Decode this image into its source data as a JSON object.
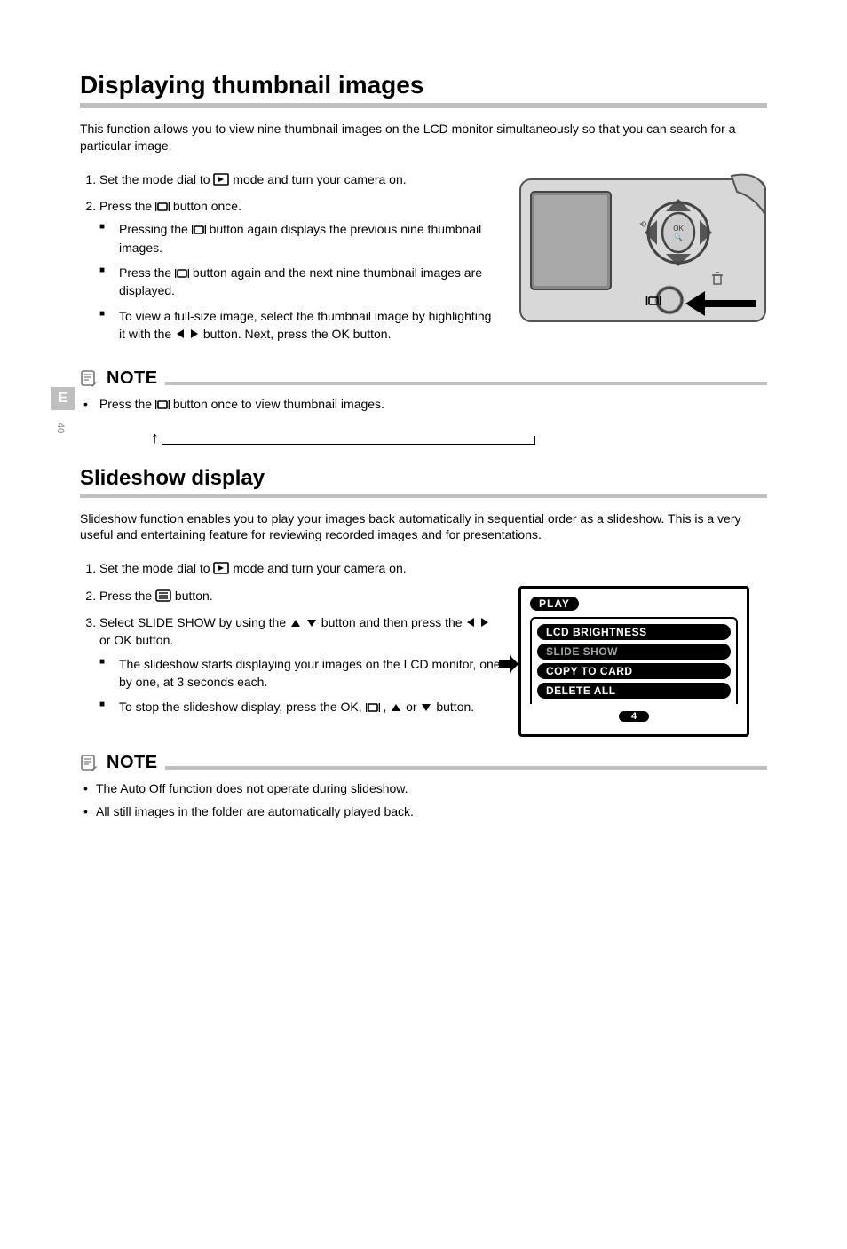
{
  "side_tab": "E",
  "page_number": "40",
  "sections": {
    "thumb": {
      "title": "Displaying thumbnail images",
      "intro": "This function allows you to view nine thumbnail images on the LCD monitor simultaneously so that you can search for a particular image.",
      "steps": {
        "s1_a": "Set the mode dial to ",
        "s1_b": " mode and turn your camera on.",
        "s2_a": "Press the ",
        "s2_b": " button once.",
        "s2_bullets": {
          "b1_a": "Pressing the ",
          "b1_b": " button again displays the previous nine thumbnail images.",
          "b2_a": "Press the ",
          "b2_b": " button again and the next nine thumbnail images are displayed.",
          "b3_a": "To view a full-size image, select the thumbnail image by highlighting it with the ",
          "b3_b": " button. Next, press the OK button."
        }
      },
      "note": {
        "label": "NOTE",
        "items": {
          "n1_a": "Press the ",
          "n1_b": " button once to view thumbnail images."
        }
      }
    },
    "slide": {
      "title": "Slideshow display",
      "intro": "Slideshow function enables you to play your images back automatically in sequential order as a slideshow. This is a very useful and entertaining feature for reviewing recorded images and for presentations.",
      "steps": {
        "s1_a": "Set the mode dial to ",
        "s1_b": " mode and turn your camera on.",
        "s2_a": "Press the ",
        "s2_b": " button.",
        "s3_a": "Select ",
        "s3_b": "SLIDE SHOW by using the ",
        "s3_c": " button and then press the ",
        "s3_d": " or OK button.",
        "s3_bullets": {
          "b1": "The slideshow starts displaying your images on the LCD monitor, one by one, at 3 seconds each.",
          "b2_a": "To stop the slideshow display, press the OK,",
          "b2_b": ", ",
          "b2_c": " or ",
          "b2_d": " button."
        }
      },
      "note": {
        "label": "NOTE",
        "items": {
          "n1": "The Auto Off function does not operate during slideshow.",
          "n2": "All still images in the folder are automatically played back."
        }
      },
      "menu": {
        "title": "PLAY",
        "items": [
          "LCD BRIGHTNESS",
          "SLIDE SHOW",
          "COPY TO CARD",
          "DELETE ALL"
        ],
        "selected_index": 1,
        "pager": "4"
      }
    }
  }
}
